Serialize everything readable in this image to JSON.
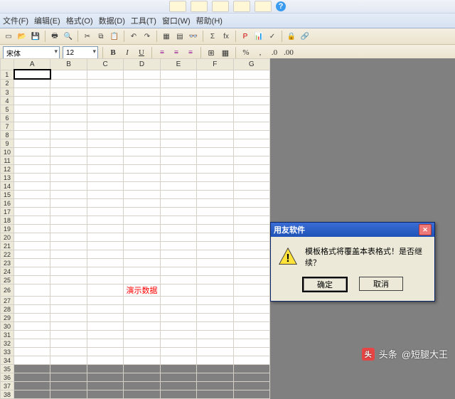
{
  "menu": {
    "items": [
      "文件(F)",
      "编辑(E)",
      "格式(O)",
      "数据(D)",
      "工具(T)",
      "窗口(W)",
      "帮助(H)"
    ]
  },
  "format": {
    "font": "宋体",
    "size": "12"
  },
  "grid": {
    "cols": [
      "A",
      "B",
      "C",
      "D",
      "E",
      "F",
      "G"
    ],
    "rows": [
      "1",
      "2",
      "3",
      "4",
      "5",
      "6",
      "7",
      "8",
      "9",
      "10",
      "11",
      "12",
      "13",
      "14",
      "15",
      "16",
      "17",
      "18",
      "19",
      "20",
      "21",
      "22",
      "23",
      "24",
      "25",
      "26",
      "27",
      "28",
      "29",
      "30",
      "31",
      "32",
      "33",
      "34",
      "35",
      "36",
      "37",
      "38"
    ],
    "watermark": "演示数据",
    "watermark_row": "26",
    "selected": "A1"
  },
  "dialog": {
    "title": "用友软件",
    "message": "模板格式将覆盖本表格式！是否继续？",
    "ok": "确定",
    "cancel": "取消"
  },
  "footer": {
    "prefix": "头条",
    "handle": "@短腿大王"
  }
}
